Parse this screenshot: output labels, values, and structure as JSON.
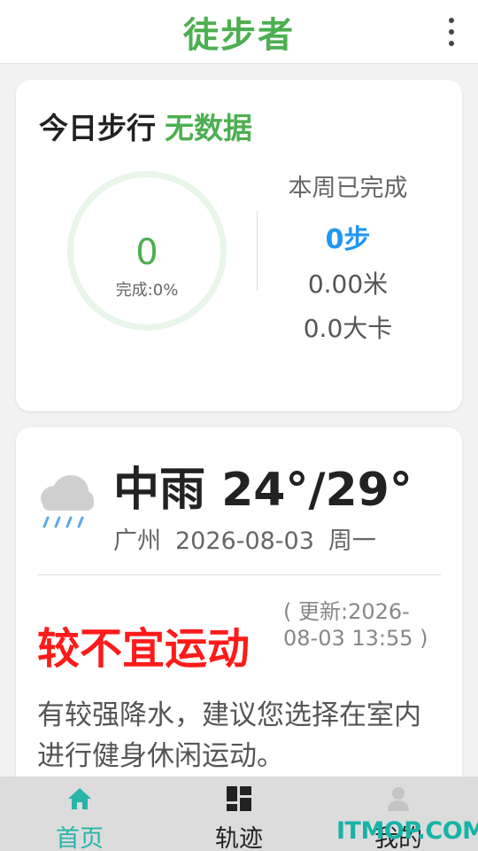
{
  "header": {
    "title": "徒步者"
  },
  "today": {
    "title": "今日步行",
    "status": "无数据",
    "steps": "0",
    "completion": "完成:0%"
  },
  "week": {
    "label": "本周已完成",
    "steps": "0步",
    "distance": "0.00米",
    "calories": "0.0大卡"
  },
  "weather": {
    "condition_temp": "中雨 24°/29°",
    "city": "广州",
    "date": "2026-08-03",
    "weekday": "周一",
    "icon": "rain-cloud-icon"
  },
  "exercise": {
    "advice": "较不宜运动",
    "update": "( 更新:2026-08-03 13:55 )",
    "description": "有较强降水，建议您选择在室内进行健身休闲运动。"
  },
  "nav": {
    "items": [
      {
        "label": "首页",
        "icon": "home-icon"
      },
      {
        "label": "轨迹",
        "icon": "grid-icon"
      },
      {
        "label": "我的",
        "icon": "person-icon"
      }
    ]
  },
  "watermark": "ITMOP.COM",
  "colors": {
    "accent_green": "#4caf50",
    "accent_blue": "#2196f3",
    "warning_red": "#ff1a1a",
    "nav_active": "#26b5a8"
  }
}
